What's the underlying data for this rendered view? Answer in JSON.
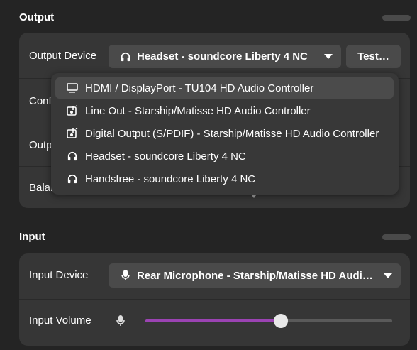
{
  "output": {
    "title": "Output",
    "device_label": "Output Device",
    "device_value": "Headset - soundcore Liberty 4 NC",
    "test_button": "Test…",
    "config_label_partial": "Conf",
    "output_label_partial": "Outp",
    "balance_label_partial": "Balar"
  },
  "dropdown": {
    "items": [
      {
        "label": "HDMI / DisplayPort - TU104 HD Audio Controller",
        "icon": "monitor-icon",
        "selected": true
      },
      {
        "label": "Line Out - Starship/Matisse HD Audio Controller",
        "icon": "audio-card-icon",
        "selected": false
      },
      {
        "label": "Digital Output (S/PDIF) - Starship/Matisse HD Audio Controller",
        "icon": "audio-card-icon",
        "selected": false
      },
      {
        "label": "Headset - soundcore Liberty 4 NC",
        "icon": "headset-icon",
        "selected": false
      },
      {
        "label": "Handsfree - soundcore Liberty 4 NC",
        "icon": "headset-icon",
        "selected": false
      }
    ]
  },
  "input": {
    "title": "Input",
    "device_label": "Input Device",
    "device_value": "Rear Microphone - Starship/Matisse HD Audio Co…",
    "volume_label": "Input Volume",
    "volume_level": 0.55
  },
  "colors": {
    "background": "#242424",
    "card": "#363636",
    "accent": "#9b43b3"
  }
}
